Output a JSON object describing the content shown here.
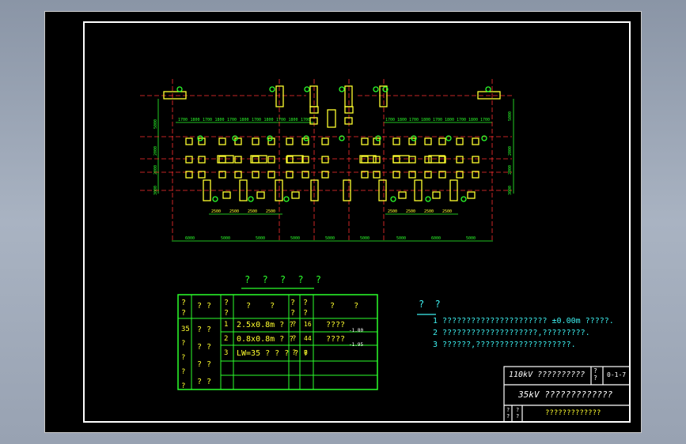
{
  "drawing": {
    "dim_labels": {
      "top_row_left": [
        "1700",
        "1800",
        "1700",
        "1800",
        "1700",
        "1800",
        "1700",
        "1800",
        "1700",
        "1800",
        "1700"
      ],
      "top_row_right": [
        "1700",
        "1800",
        "1700",
        "1800",
        "1700",
        "1800",
        "1700",
        "1800",
        "1700"
      ],
      "bottom_bays": [
        "6000",
        "5000",
        "5000",
        "5000",
        "5000",
        "5000",
        "5000",
        "6000",
        "5000"
      ],
      "sub_dims_left": [
        "2500",
        "2500",
        "2500",
        "2500"
      ],
      "sub_dims_right": [
        "2500",
        "2500",
        "2500",
        "2500"
      ],
      "left_vert": [
        "5000",
        "2000",
        "2000",
        "3000"
      ],
      "right_vert": [
        "5000",
        "2000",
        "2000",
        "3000"
      ],
      "mid_vert": [
        "2000",
        "2000"
      ]
    },
    "table_title": "? ? ? ? ?",
    "table": {
      "header": [
        "?\n?",
        "? ?",
        "?\n?",
        "?    ?",
        "?\n?",
        "?\n?",
        "?    ?"
      ],
      "col0": [
        "35",
        "?",
        "?",
        "?",
        "?"
      ],
      "col1": [
        "? ?",
        "? ?",
        "? ?",
        "? ?"
      ],
      "rows": [
        {
          "no": "1",
          "name": "2.5x0.8m ? ?",
          "unit": "?",
          "qty": "16",
          "note": "????",
          "note_val": "-1.80"
        },
        {
          "no": "2",
          "name": "0.8x0.8m ? ?",
          "unit": "?",
          "qty": "44",
          "note": "????",
          "note_val": "-1.95"
        },
        {
          "no": "3",
          "name": "LW=35  ? ? ? ? ?",
          "unit": "?",
          "qty": "6",
          "note": "",
          "note_val": ""
        }
      ]
    },
    "notes_title": "? ?",
    "notes": [
      "1 ??????????????????????  ±0.00m  ?????.",
      "2 ????????????????????,?????????.",
      "3 ??????,????????????????????."
    ],
    "title_block": {
      "row1": "110kV ??????????",
      "row1_side": "?\n?",
      "drawing_no": "0-1-7",
      "row2": "35kV ?????????????",
      "row3_left1": "?\n?",
      "row3_left2": "?\n?",
      "row3": "?????????????"
    },
    "colors": {
      "background": "#000000",
      "border": "#ffffff",
      "dimension": "#2bff2b",
      "foundation": "#ffff2e",
      "axis": "#ff3030",
      "notes": "#3df0f0"
    }
  }
}
